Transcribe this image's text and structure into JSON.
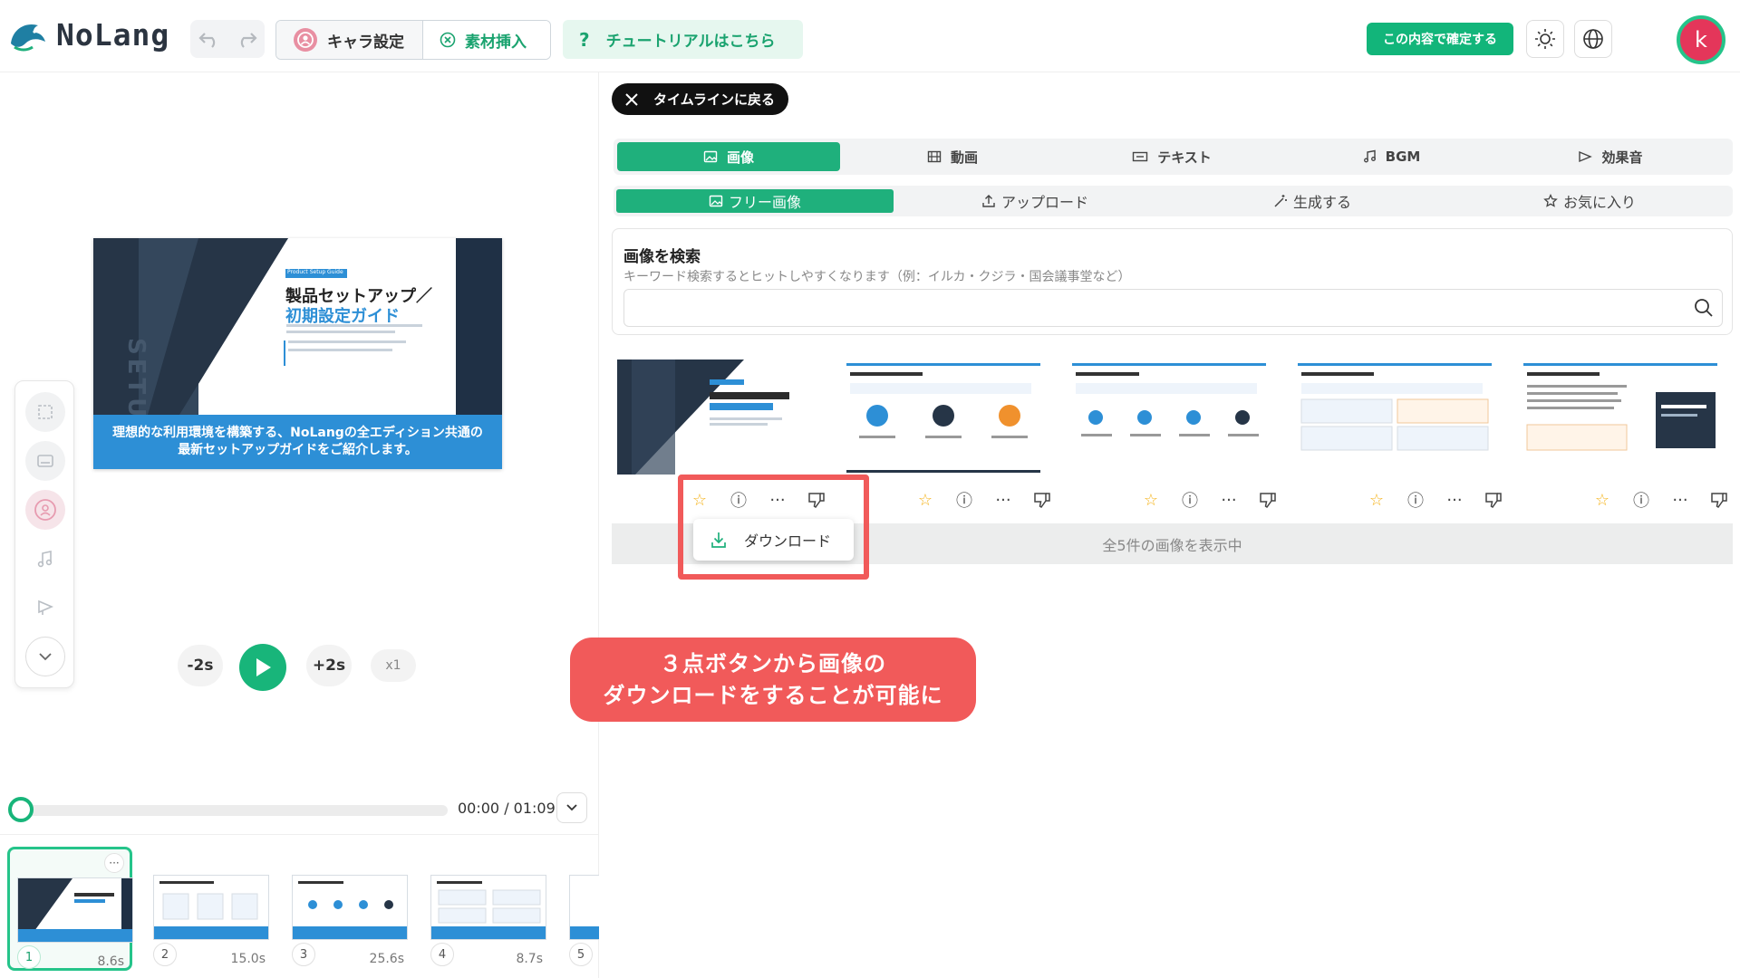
{
  "app": {
    "logo_text": "NoLang",
    "avatar_letter": "k",
    "brand_color": "#1fb07c",
    "accent_red": "#f15a5a"
  },
  "header": {
    "chara_tab": "キャラ設定",
    "material_tab": "素材挿入",
    "tutorial": "チュートリアルはこちら",
    "confirm": "この内容で確定する",
    "icons": [
      "undo-icon",
      "redo-icon",
      "sun-icon",
      "globe-icon"
    ]
  },
  "preview": {
    "slide": {
      "tag": "Product Setup Guide",
      "vertical_text": "SETUP GUIDE",
      "title_line1": "製品セットアップ／",
      "title_line2": "初期設定ガイド",
      "footer_line1": "理想的な利用環境を構築する、NoLangの全エディション共通の",
      "footer_line2": "最新セットアップガイドをご紹介します。"
    },
    "controls": {
      "back": "-2s",
      "forward": "+2s",
      "rate": "x1"
    },
    "time": "00:00 / 01:09",
    "progress": 0
  },
  "timeline": {
    "items": [
      {
        "num": "1",
        "duration": "8.6s"
      },
      {
        "num": "2",
        "duration": "15.0s"
      },
      {
        "num": "3",
        "duration": "25.6s"
      },
      {
        "num": "4",
        "duration": "8.7s"
      },
      {
        "num": "5",
        "duration": ""
      }
    ],
    "more": "···"
  },
  "panel": {
    "back_button": "タイムラインに戻る",
    "media_tabs": [
      "画像",
      "動画",
      "テキスト",
      "BGM",
      "効果音"
    ],
    "image_tabs": [
      "フリー画像",
      "アップロード",
      "生成する",
      "お気に入り"
    ],
    "search": {
      "title": "画像を検索",
      "hint": "キーワード検索するとヒットしやすくなります（例：イルカ・クジラ・国会議事堂など）",
      "placeholder": ""
    },
    "result_text": "全5件の画像を表示中",
    "dropdown_download": "ダウンロード",
    "image_action_icons": [
      "star-icon",
      "info-icon",
      "more-icon",
      "thumbs-down-icon"
    ]
  },
  "annotation": {
    "line1": "３点ボタンから画像の",
    "line2": "ダウンロードをすることが可能に"
  }
}
